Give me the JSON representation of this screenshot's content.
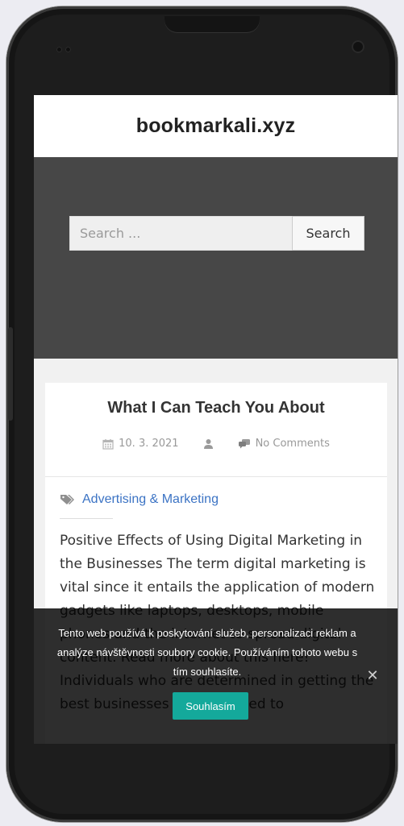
{
  "site": {
    "title": "bookmarkali.xyz"
  },
  "search": {
    "placeholder": "Search ...",
    "button_label": "Search"
  },
  "post": {
    "title": "What I Can Teach You About",
    "date": "10. 3. 2021",
    "comments": "No Comments",
    "category": "Advertising & Marketing",
    "excerpt": "Positive Effects of Using Digital Marketing in the Businesses The term digital marketing is vital since it entails the application of modern gadgets like laptops, desktops, mobile phones and the internet to spread digital content. Read more about this here! Individuals who are determined in getting the best businesses are supposed to"
  },
  "cookie": {
    "message": "Tento web používá k poskytování služeb, personalizaci reklam a analýze návštěvnosti soubory cookie. Používáním tohoto webu s tím souhlasíte.",
    "accept_label": "Souhlasím"
  },
  "colors": {
    "accent": "#14a99b",
    "link": "#3b73c4",
    "band": "#474747"
  },
  "icons": [
    "calendar-icon",
    "user-icon",
    "comments-icon",
    "tags-icon",
    "close-icon"
  ]
}
